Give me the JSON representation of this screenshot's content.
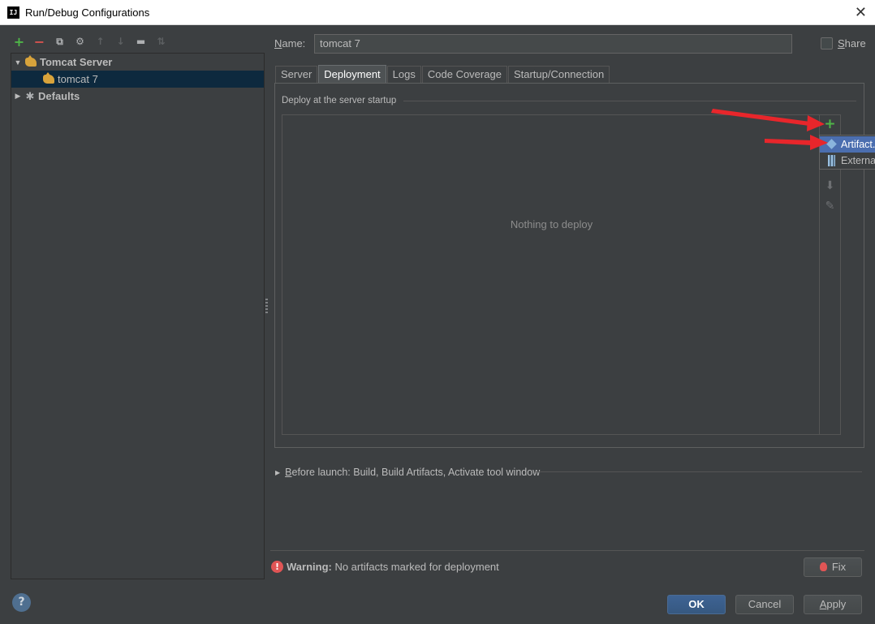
{
  "window": {
    "title": "Run/Debug Configurations",
    "app_icon_text": "IJ",
    "close_glyph": "✕"
  },
  "toolbar": {
    "add": "+",
    "remove": "−",
    "copy": "⧉",
    "edit": "⚙",
    "up": "↑",
    "down": "↓",
    "folder": "▬",
    "sort": "⇅"
  },
  "tree": {
    "group_label": "Tomcat Server",
    "child_label": "tomcat 7",
    "defaults_label": "Defaults",
    "expanded_glyph": "▼",
    "collapsed_glyph": "▶"
  },
  "name_field": {
    "label_prefix": "N",
    "label_rest": "ame:",
    "value": "tomcat 7"
  },
  "share": {
    "label_prefix": "S",
    "label_rest": "hare",
    "checked": false
  },
  "tabs": [
    {
      "label": "Server",
      "active": false
    },
    {
      "label": "Deployment",
      "active": true
    },
    {
      "label": "Logs",
      "active": false
    },
    {
      "label": "Code Coverage",
      "active": false
    },
    {
      "label": "Startup/Connection",
      "active": false
    }
  ],
  "deployment": {
    "section_label": "Deploy at the server startup",
    "empty_text": "Nothing to deploy",
    "add_glyph": "+",
    "down_glyph": "⬇",
    "edit_glyph": "✎"
  },
  "popup_menu": {
    "items": [
      {
        "label": "Artifact...",
        "selected": true,
        "icon": "artifact-icon"
      },
      {
        "label": "External Source...",
        "selected": false,
        "icon": "jar-icon"
      }
    ]
  },
  "before_launch": {
    "arrow": "▶",
    "label_prefix": "B",
    "label_rest": "efore launch: Build, Build Artifacts, Activate tool window"
  },
  "warning": {
    "icon": "!",
    "title": "Warning:",
    "message": " No artifacts marked for deployment"
  },
  "buttons": {
    "fix": "Fix",
    "ok": "OK",
    "cancel": "Cancel",
    "apply_prefix": "A",
    "apply_rest": "pply",
    "help": "?"
  },
  "colors": {
    "accent": "#4b6eaf",
    "background": "#3c3f41",
    "annotation": "#e8262b",
    "add": "#4fb548"
  }
}
